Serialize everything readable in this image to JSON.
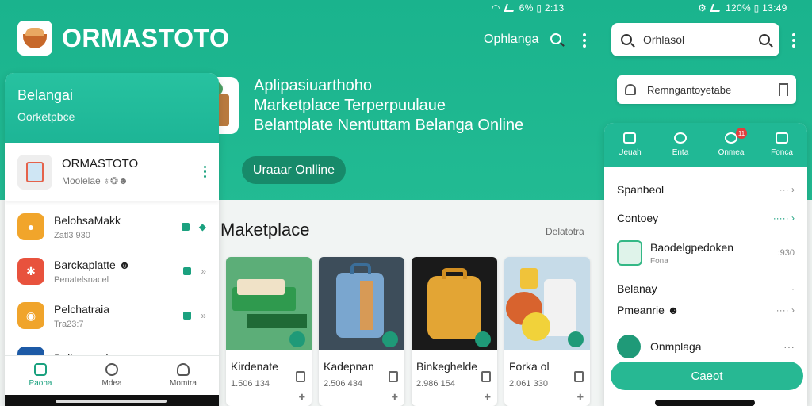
{
  "status_left": {
    "text": "6% ▯ 2:13"
  },
  "status_right": {
    "text": "120% ▯ 13:49"
  },
  "header": {
    "app_title": "ORMASTOTO",
    "link": "Ophlanga"
  },
  "search": {
    "value": "Orhlasol"
  },
  "bookmark_bar": {
    "text": "Remngantoyetabe"
  },
  "hero": {
    "line1": "Aplipasiuarthoho",
    "line2": "Marketplace Terperpuulaue",
    "line3": "Belantplate  Nentuttam Belanga Online",
    "cta": "Uraaar Onlline"
  },
  "left_phone": {
    "head_title": "Belangai",
    "head_sub": "Oorketpbce",
    "card_name": "ORMASTOTO",
    "card_sub": "Moolelae ♁❂☻",
    "items": [
      {
        "name": "BelohsaMakk",
        "sub": "Zatl3 930",
        "color": "#f1a52b"
      },
      {
        "name": "Barckaplatte ☻",
        "sub": "Penatelsnacel",
        "color": "#e8523d"
      },
      {
        "name": "Pelchatraia",
        "sub": "Tra23:7",
        "color": "#f0a42b"
      },
      {
        "name": "Ballamacel",
        "sub": "",
        "color": "#1d5aa6"
      }
    ],
    "nav": [
      "Paoha",
      "Mdea",
      "Momtra"
    ]
  },
  "marketplace": {
    "title": "Maketplace",
    "more": "Delatotra",
    "products": [
      {
        "name": "Kirdenate",
        "price": "1.506 134",
        "sm": "✚"
      },
      {
        "name": "Kadepnan",
        "price": "2.506 434",
        "sm": "✚"
      },
      {
        "name": "Binkeghelde",
        "price": "2.986 154",
        "sm": "✚"
      },
      {
        "name": "Forka ol",
        "price": "2.061 330",
        "sm": "✚"
      }
    ]
  },
  "right_phone": {
    "tabs": [
      "Ueuah",
      "Enta",
      "Onmea",
      "Fonca"
    ],
    "tab_badge": "11",
    "row1": "Spanbeol",
    "row2": "Contoey",
    "store_name": "Baodelgpedoken",
    "store_sub": "Fona",
    "store_meta": ":930",
    "row3": "Belanay",
    "row4": "Pmeanrie ☻",
    "online": "Onmplaga",
    "button": "Caeot"
  },
  "colors": {
    "primary": "#1fb38c",
    "dark": "#178a6a",
    "surface": "#ffffff"
  }
}
